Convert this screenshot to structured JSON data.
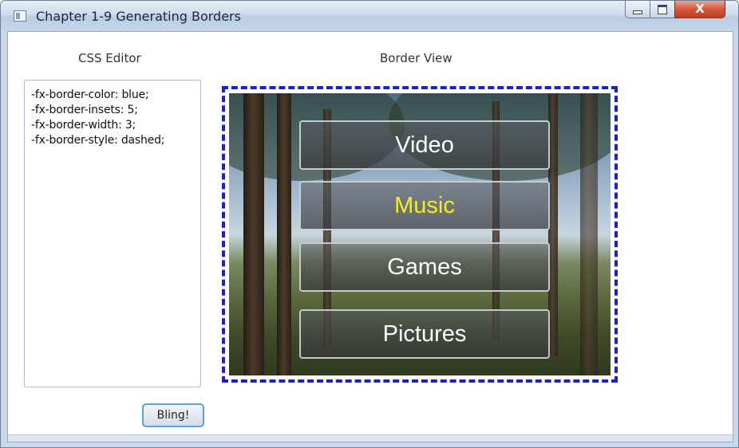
{
  "window": {
    "title": "Chapter 1-9 Generating Borders",
    "controls": {
      "close_glyph": "X"
    }
  },
  "labels": {
    "css_editor": "CSS Editor",
    "border_view": "Border View"
  },
  "editor": {
    "lines": [
      "-fx-border-color: blue;",
      "-fx-border-insets: 5;",
      "-fx-border-width: 3;",
      "-fx-border-style: dashed;"
    ]
  },
  "bling_button": {
    "label": "Bling!"
  },
  "menu": {
    "items": [
      {
        "label": "Video"
      },
      {
        "label": "Music"
      },
      {
        "label": "Games"
      },
      {
        "label": "Pictures"
      }
    ],
    "selected_color": "#f4ee1c"
  },
  "colors": {
    "border_dashed": "#1b21c9",
    "focus_ring": "#5ea1d6",
    "close_button": "#c13b1f"
  }
}
